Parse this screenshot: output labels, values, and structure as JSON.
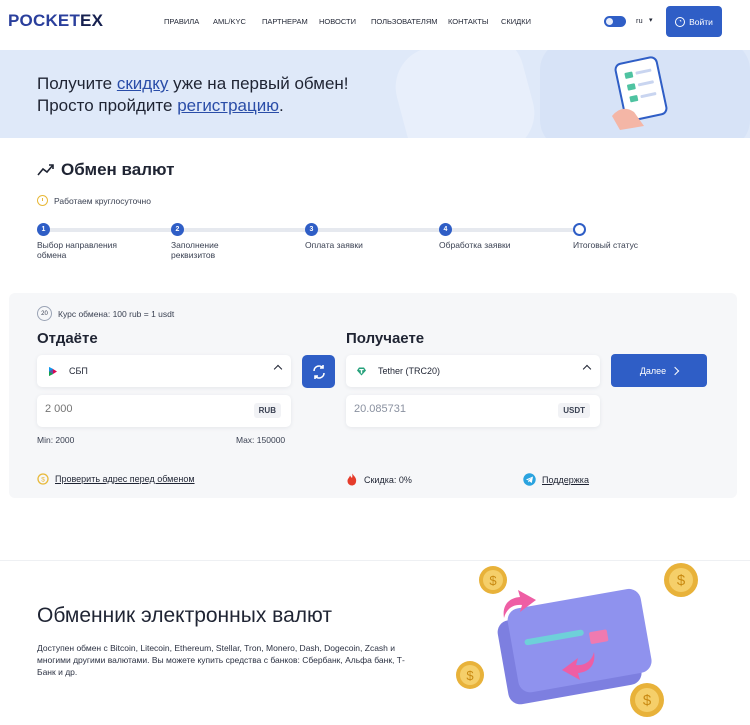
{
  "header": {
    "logo_main": "POCKET",
    "logo_accent": "EX",
    "nav": [
      "ПРАВИЛА",
      "AML/KYC",
      "ПАРТНЕРАМ",
      "НОВОСТИ",
      "ПОЛЬЗОВАТЕЛЯМ",
      "КОНТАКТЫ",
      "СКИДКИ"
    ],
    "lang": "ru",
    "login_label": "Войти"
  },
  "banner": {
    "line1_before": "Получите ",
    "line1_link": "скидку",
    "line1_after": " уже на первый обмен!",
    "line2_before": "Просто пройдите ",
    "line2_link": "регистрацию",
    "line2_after": "."
  },
  "exchange": {
    "title": "Обмен валют",
    "hours": "Работаем круглосуточно",
    "steps": [
      {
        "num": "1",
        "label": "Выбор направления обмена"
      },
      {
        "num": "2",
        "label": "Заполнение реквизитов"
      },
      {
        "num": "3",
        "label": "Оплата заявки"
      },
      {
        "num": "4",
        "label": "Обработка заявки"
      },
      {
        "num": "",
        "label": "Итоговый статус"
      }
    ],
    "rate_badge": "20",
    "rate_text": "Курс обмена: 100 rub = 1 usdt",
    "give_title": "Отдаёте",
    "get_title": "Получаете",
    "give_currency": "СБП",
    "get_currency": "Tether (TRC20)",
    "give_amount_placeholder": "2 000",
    "give_unit": "RUB",
    "get_amount": "20.085731",
    "get_unit": "USDT",
    "min_text": "Min: 2000",
    "max_text": "Max: 150000",
    "next_label": "Далее",
    "check_address": "Проверить адрес перед обменом",
    "discount": "Скидка: 0%",
    "support": "Поддержка"
  },
  "about": {
    "title": "Обменник электронных валют",
    "text": "Доступен обмен с Bitcoin, Litecoin, Ethereum, Stellar, Tron, Monero, Dash, Dogecoin, Zcash и многими другими валютами. Вы можете купить средства с банков: Сбербанк, Альфа банк, Т-Банк и др."
  },
  "colors": {
    "accent": "#2f5ec6",
    "banner_bg": "#dfe9f9",
    "panel_bg": "#f6f7f9"
  }
}
